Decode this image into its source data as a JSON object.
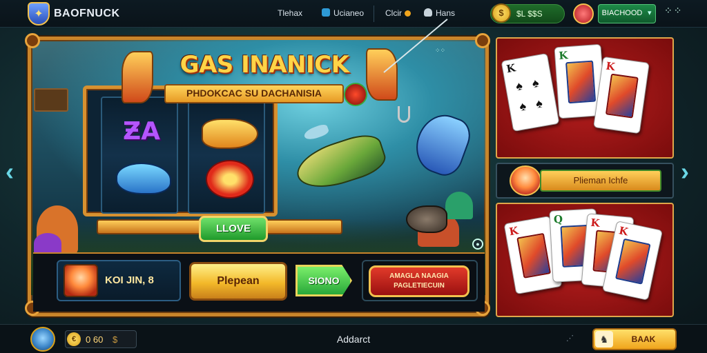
{
  "header": {
    "logo_text": "BAOFNUCK",
    "nav": [
      {
        "label": "Tlehax"
      },
      {
        "label": "Ucianeo"
      },
      {
        "label": "Clcir"
      },
      {
        "label": "Hans"
      }
    ],
    "coin_balance": "$L $$S",
    "balance_label": "BIACHOOD"
  },
  "game": {
    "title": "GAS INANICK",
    "subtitle": "PHDOKCAC SU DACHANISIA",
    "reels_button": "LLOVE",
    "player_name": "KOI JIN, 8",
    "play_button": "Plepean",
    "spin_button": "SIONO",
    "promo_text": "AMAGLA NAAGIA PAGLETIECUIN"
  },
  "side_panel": {
    "banner_text": "Plieman Ichfe",
    "top_cards": [
      {
        "rank": "K",
        "suit": "♠",
        "color": "#111111",
        "face": false
      },
      {
        "rank": "K",
        "suit": "♠",
        "color": "#1a7a2a",
        "face": true
      },
      {
        "rank": "K",
        "suit": "♦",
        "color": "#cc1a1a",
        "face": true
      }
    ],
    "bottom_cards": [
      {
        "rank": "K",
        "suit": "♦",
        "color": "#cc1a1a",
        "face": true
      },
      {
        "rank": "Q",
        "suit": "♣",
        "color": "#1a7a2a",
        "face": true
      },
      {
        "rank": "K",
        "suit": "♥",
        "color": "#cc1a1a",
        "face": true
      },
      {
        "rank": "K",
        "suit": "♦",
        "color": "#cc1a1a",
        "face": true
      }
    ]
  },
  "footer": {
    "coin_text": "0 60",
    "coin_currency": "$",
    "center_label": "Addarct",
    "action_button": "BAAK"
  },
  "colors": {
    "gold": "#f2c14e",
    "frame": "#c9852a",
    "card_panel": "#b81e1e",
    "green_button": "#28a83a"
  }
}
